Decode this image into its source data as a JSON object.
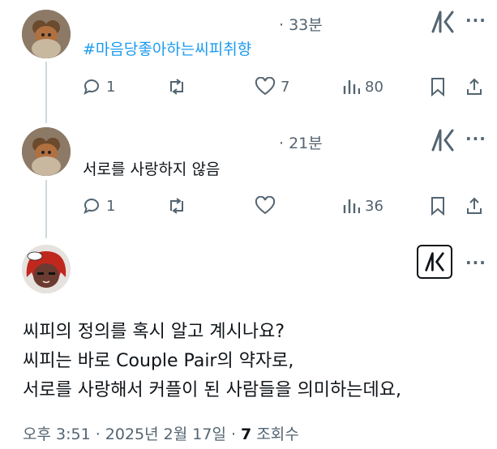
{
  "tweets": [
    {
      "meta": "· 33분",
      "text": "#마음당좋아하는씨피취향",
      "replies": "1",
      "retweets": "",
      "likes": "7",
      "views": "80"
    },
    {
      "meta": "· 21분",
      "text": "서로를 사랑하지 않음",
      "replies": "1",
      "retweets": "",
      "likes": "",
      "views": "36"
    }
  ],
  "main_tweet": {
    "lines": [
      "씨피의 정의를 혹시 알고 계시나요?",
      "씨피는 바로 Couple Pair의 약자로,",
      "서로를 사랑해서 커플이 된 사람들을 의미하는데요,"
    ],
    "time": "오후 3:51 · 2025년 2월 17일 · ",
    "views_count": "7",
    "views_label": " 조회수"
  },
  "icons": {
    "reply": "reply-icon",
    "retweet": "retweet-icon",
    "like": "like-icon",
    "views": "views-icon",
    "bookmark": "bookmark-icon",
    "share": "share-icon",
    "grok": "grok-icon",
    "more": "more-icon"
  },
  "colors": {
    "hashtag": "#1d9bf0",
    "secondary": "#536471",
    "primary": "#0f1419",
    "thread_line": "#cfd9de"
  }
}
